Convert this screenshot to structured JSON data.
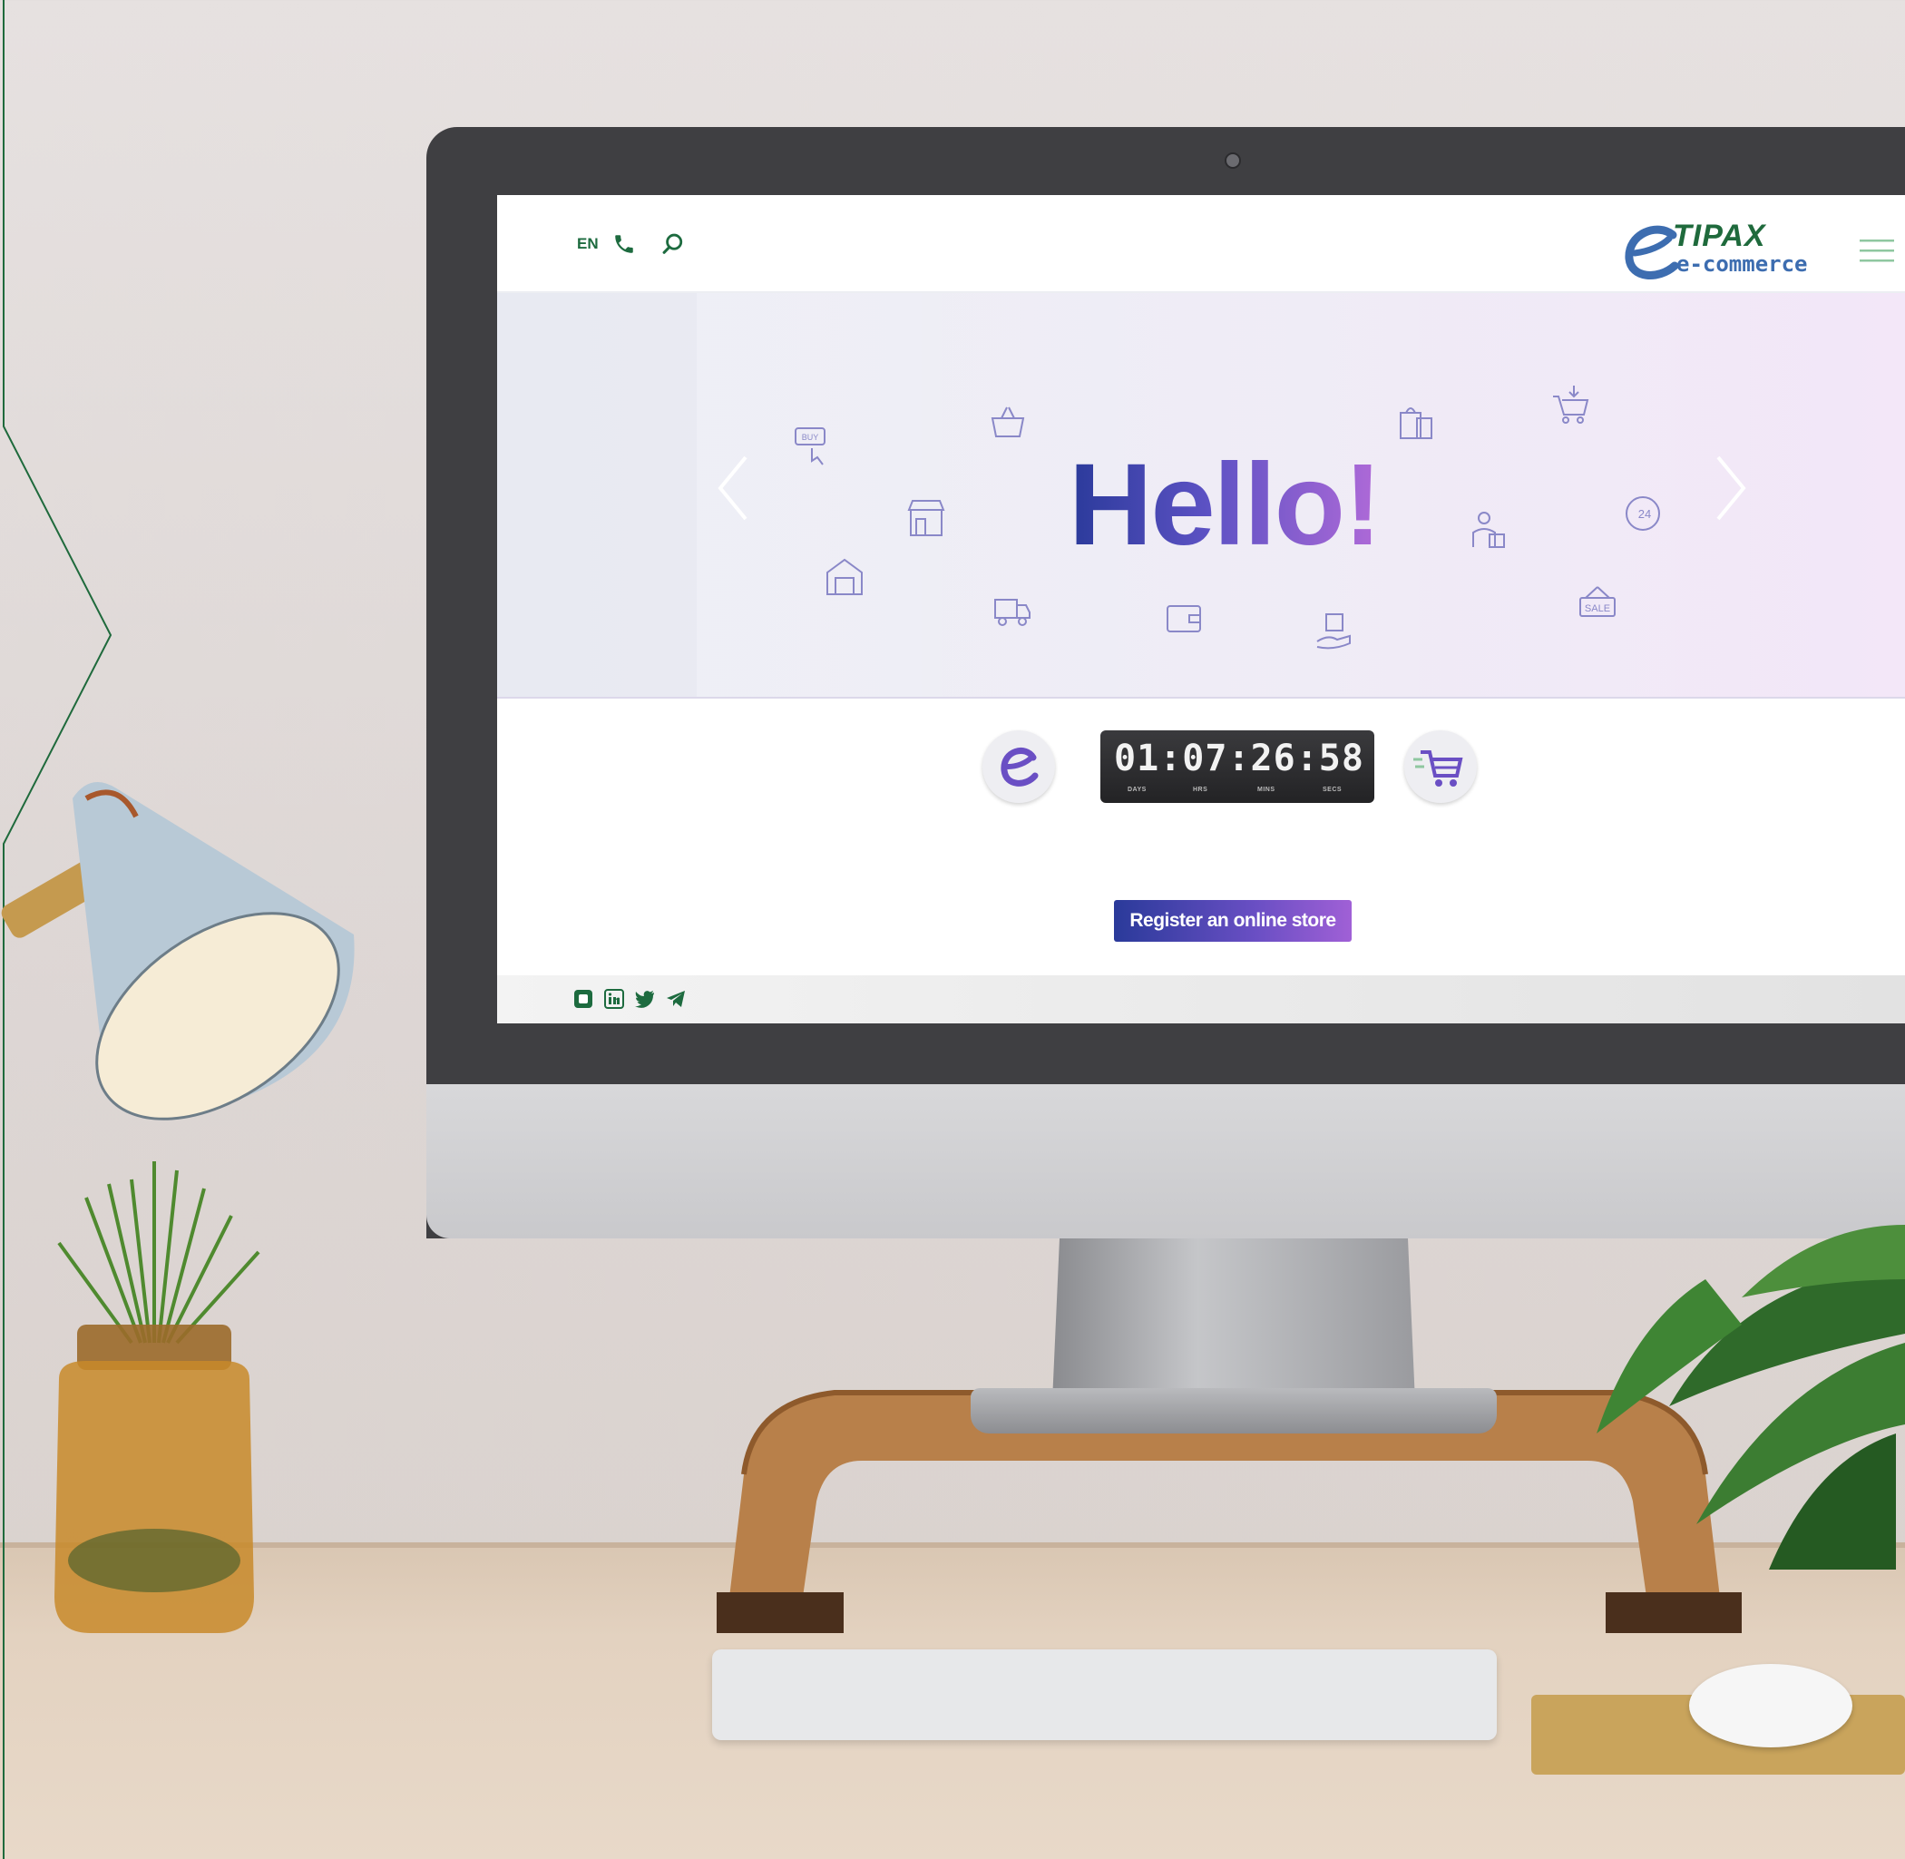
{
  "header": {
    "language": "EN",
    "brand_name": "TIPAX",
    "brand_sub": "e-commerce"
  },
  "hero": {
    "headline": "Hello!",
    "icon_labels": [
      "BUY",
      "24",
      "SALE"
    ]
  },
  "countdown": {
    "days": "01",
    "hours": "07",
    "mins": "26",
    "secs": "58",
    "labels": {
      "days": "DAYS",
      "hours": "HRS",
      "mins": "MINS",
      "secs": "SECS"
    }
  },
  "cta": {
    "register_label": "Register an online store"
  },
  "colors": {
    "brand_green": "#1d6b3f",
    "brand_blue": "#2a3a9a",
    "brand_purple": "#a060d6"
  },
  "social_icons": [
    "instagram-icon",
    "linkedin-icon",
    "twitter-icon",
    "telegram-icon"
  ]
}
